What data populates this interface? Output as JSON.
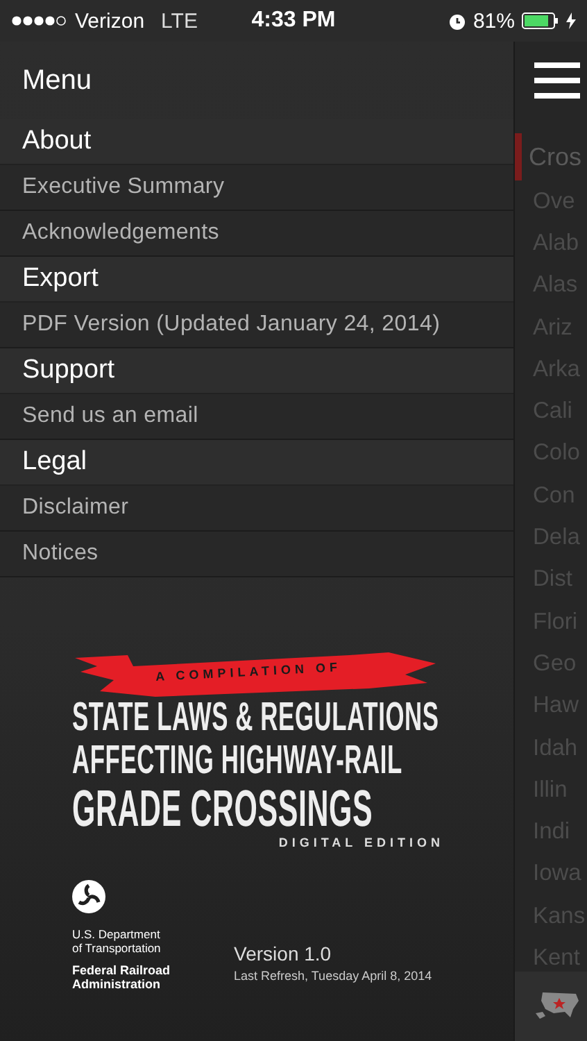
{
  "status_bar": {
    "carrier": "Verizon",
    "network": "LTE",
    "time": "4:33 PM",
    "battery": "81%"
  },
  "menu": {
    "title": "Menu",
    "sections": [
      {
        "title": "About",
        "items": [
          "Executive Summary",
          "Acknowledgements"
        ]
      },
      {
        "title": "Export",
        "items": [
          "PDF Version (Updated January 24, 2014)"
        ]
      },
      {
        "title": "Support",
        "items": [
          "Send us an email"
        ]
      },
      {
        "title": "Legal",
        "items": [
          "Disclaimer",
          "Notices"
        ]
      }
    ]
  },
  "logo": {
    "banner": "A COMPILATION OF",
    "lines": [
      "STATE LAWS & REGULATIONS",
      "AFFECTING HIGHWAY-RAIL",
      "GRADE CROSSINGS"
    ],
    "edition": "DIGITAL EDITION"
  },
  "agency": {
    "department": [
      "U.S. Department",
      "of Transportation"
    ],
    "administration": [
      "Federal Railroad",
      "Administration"
    ]
  },
  "version": {
    "label": "Version 1.0",
    "refresh": "Last Refresh, Tuesday April 8, 2014"
  },
  "content": {
    "header": "Cros",
    "items": [
      "Ove",
      "Alab",
      "Alas",
      "Ariz",
      "Arka",
      "Cali",
      "Colo",
      "Con",
      "Dela",
      "Dist",
      "Flori",
      "Geo",
      "Haw",
      "Idah",
      "Illin",
      "Indi",
      "Iowa",
      "Kans",
      "Kent"
    ]
  }
}
